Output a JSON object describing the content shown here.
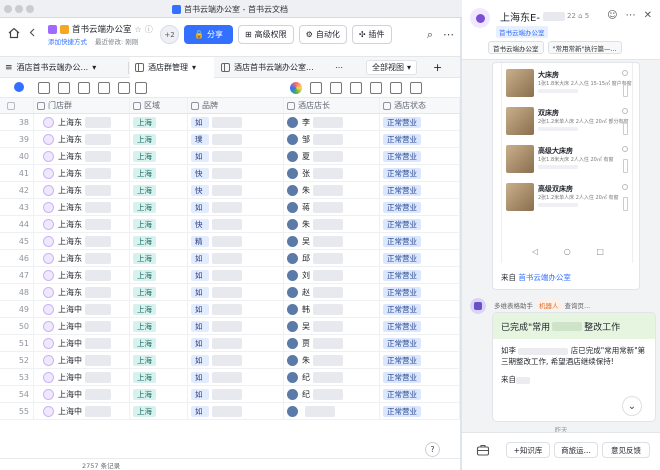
{
  "window": {
    "title": "首书云端办公室 - 首书云文档"
  },
  "doc": {
    "title": "首书云端办公室",
    "add_shortcut": "添加快捷方式",
    "last_modified": "最近修改: 刚刚",
    "collab_more": "+2",
    "share_label": "分享",
    "advanced_perm_label": "高级权限",
    "automation_label": "自动化",
    "plugin_label": "插件"
  },
  "tabs": {
    "table1": "酒店首书云端办公...",
    "table2": "酒店群管理",
    "table3": "酒店首书云端办公室...",
    "view": "全部视图",
    "add": "+"
  },
  "grid": {
    "headers": {
      "group": "门店群",
      "region": "区域",
      "brand": "品牌",
      "manager": "酒店店长",
      "status": "酒店状态"
    },
    "rows": [
      {
        "n": "38",
        "g": "上海东",
        "r": "上海",
        "b": "如",
        "m": "李",
        "s": "正常营业"
      },
      {
        "n": "39",
        "g": "上海东",
        "r": "上海",
        "b": "璞",
        "m": "邹",
        "s": "正常营业"
      },
      {
        "n": "40",
        "g": "上海东",
        "r": "上海",
        "b": "如",
        "m": "夏",
        "s": "正常营业"
      },
      {
        "n": "41",
        "g": "上海东",
        "r": "上海",
        "b": "快",
        "m": "张",
        "s": "正常营业"
      },
      {
        "n": "42",
        "g": "上海东",
        "r": "上海",
        "b": "快",
        "m": "朱",
        "s": "正常营业"
      },
      {
        "n": "43",
        "g": "上海东",
        "r": "上海",
        "b": "如",
        "m": "蒋",
        "s": "正常营业"
      },
      {
        "n": "44",
        "g": "上海东",
        "r": "上海",
        "b": "快",
        "m": "朱",
        "s": "正常营业"
      },
      {
        "n": "45",
        "g": "上海东",
        "r": "上海",
        "b": "精",
        "m": "吴",
        "s": "正常营业"
      },
      {
        "n": "46",
        "g": "上海东",
        "r": "上海",
        "b": "如",
        "m": "邱",
        "s": "正常营业"
      },
      {
        "n": "47",
        "g": "上海东",
        "r": "上海",
        "b": "如",
        "m": "刘",
        "s": "正常营业"
      },
      {
        "n": "48",
        "g": "上海东",
        "r": "上海",
        "b": "如",
        "m": "赵",
        "s": "正常营业"
      },
      {
        "n": "49",
        "g": "上海中",
        "r": "上海",
        "b": "如",
        "m": "韩",
        "s": "正常营业"
      },
      {
        "n": "50",
        "g": "上海中",
        "r": "上海",
        "b": "如",
        "m": "吴",
        "s": "正常营业"
      },
      {
        "n": "51",
        "g": "上海中",
        "r": "上海",
        "b": "如",
        "m": "贾",
        "s": "正常营业"
      },
      {
        "n": "52",
        "g": "上海中",
        "r": "上海",
        "b": "如",
        "m": "朱",
        "s": "正常营业"
      },
      {
        "n": "53",
        "g": "上海中",
        "r": "上海",
        "b": "如",
        "m": "纪",
        "s": "正常营业"
      },
      {
        "n": "54",
        "g": "上海中",
        "r": "上海",
        "b": "如",
        "m": "纪",
        "s": "正常营业"
      },
      {
        "n": "55",
        "g": "上海中",
        "r": "上海",
        "b": "如",
        "m": "",
        "s": "正常营业"
      }
    ]
  },
  "footer": {
    "count": "2757 条记录"
  },
  "chat": {
    "name": "上海东E-",
    "meta": "22 ⌂ 5",
    "tag": "首书云端办公室",
    "chip1": "首书云端办公室",
    "chip2": "\"常用常新\"执行篇—...",
    "rooms": [
      {
        "title": "大床房",
        "desc": "1张1.8米大床 2人入住 15-15㎡ 窗户有窗"
      },
      {
        "title": "双床房",
        "desc": "2张1.2米单人床 2人入住 20㎡ 部分有窗"
      },
      {
        "title": "高级大床房",
        "desc": "1张1.8米大床 2人入住 20㎡ 有窗"
      },
      {
        "title": "高级双床房",
        "desc": "2张1.2米单人床 2人入住 20㎡ 有窗"
      }
    ],
    "nav_back": "◁",
    "nav_home": "○",
    "nav_menu": "□",
    "from_prefix": "来自",
    "from_link": "首书云端办公室",
    "bot_name": "多维表格助手",
    "bot_tag": "机器人",
    "bot_extra": "查询页...",
    "bot_title_a": "已完成\"常用",
    "bot_title_b": "整改工作",
    "bot_body_a": "如李",
    "bot_body_b": "店已完成\"常用常新\"第三期整改工作, 希望酒店继续保持!",
    "bot_from": "来自",
    "day": "昨天",
    "btn_kb": "知识库",
    "btn_ops": "商旅运...",
    "btn_feedback": "意见反馈"
  }
}
